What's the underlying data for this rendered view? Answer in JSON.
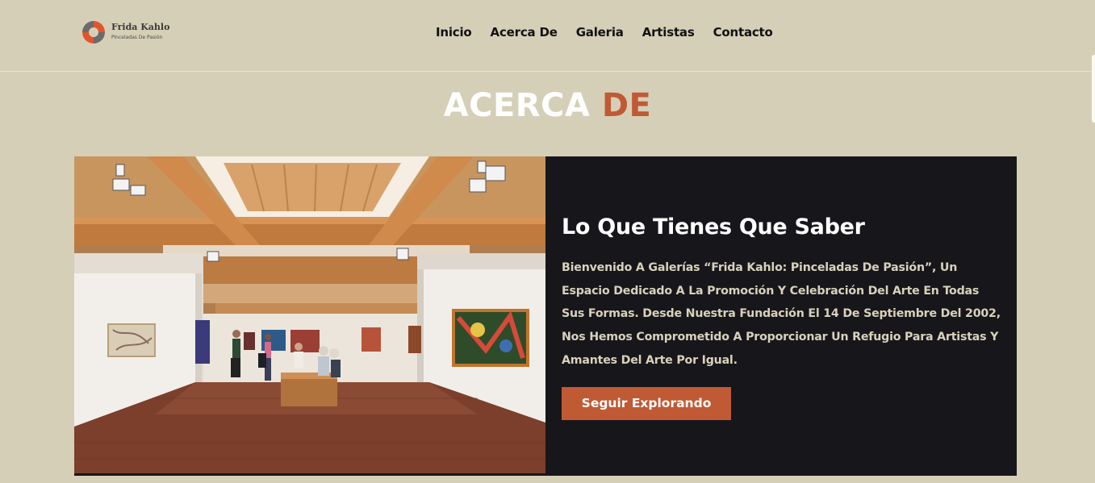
{
  "brand": {
    "name": "Frida Kahlo",
    "tagline": "Pinceladas De Pasión",
    "colors": {
      "accent": "#bf5a35",
      "background": "#d6cfb7",
      "card": "#17161b"
    }
  },
  "nav": {
    "items": [
      {
        "label": "Inicio"
      },
      {
        "label": "Acerca De"
      },
      {
        "label": "Galeria"
      },
      {
        "label": "Artistas"
      },
      {
        "label": "Contacto"
      }
    ]
  },
  "page": {
    "title_word1": "ACERCA",
    "title_word2": "DE"
  },
  "about": {
    "heading": "Lo Que Tienes Que Saber",
    "body": "Bienvenido A Galerías “Frida Kahlo: Pinceladas De Pasión”, Un Espacio Dedicado A La Promoción Y Celebración Del Arte En Todas Sus Formas. Desde Nuestra Fundación El 14 De Septiembre Del 2002, Nos Hemos Comprometido A Proporcionar Un Refugio Para Artistas Y Amantes Del Arte Por Igual.",
    "button_label": "Seguir Explorando",
    "image_icon": "gallery-interior-photo"
  }
}
